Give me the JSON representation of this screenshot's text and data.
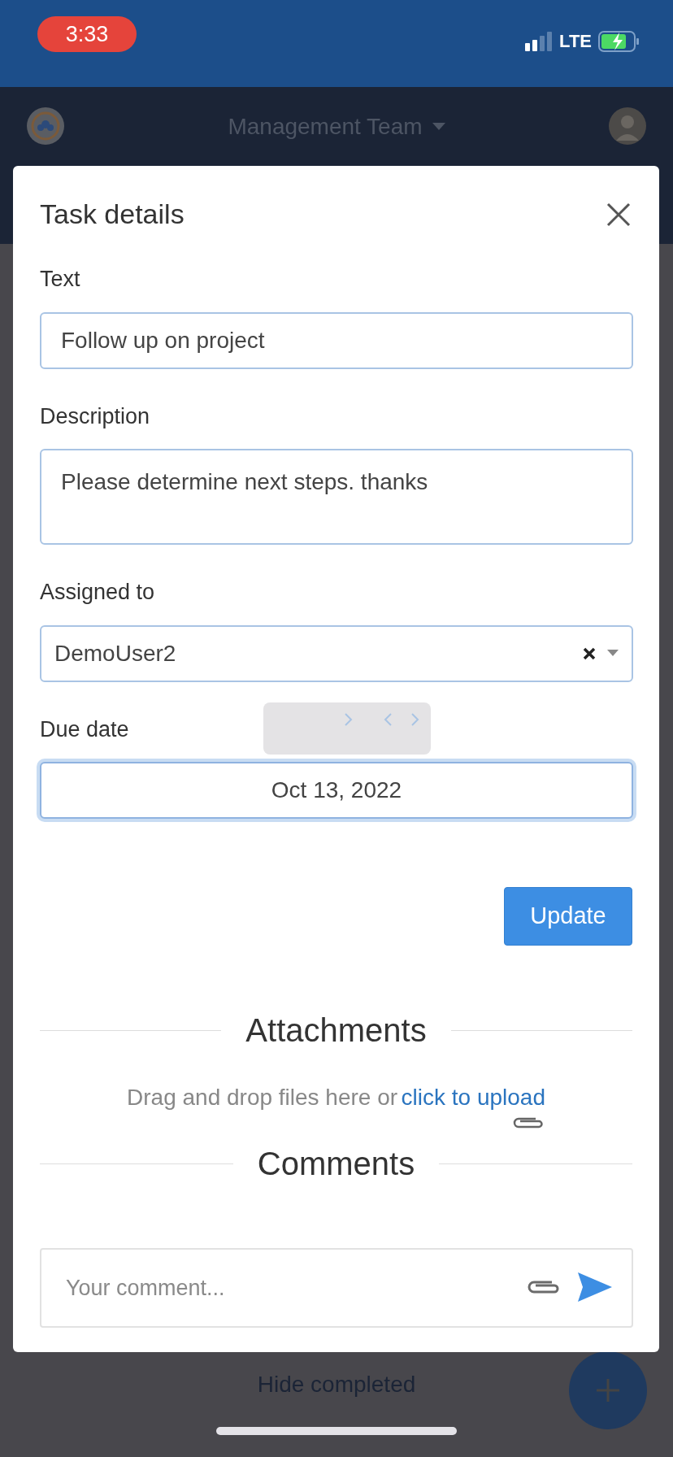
{
  "status_bar": {
    "time": "3:33",
    "network": "LTE"
  },
  "header": {
    "team": "Management Team"
  },
  "page": {
    "hide_completed": "Hide completed"
  },
  "modal": {
    "title": "Task details",
    "fields": [
      {
        "kind": "input",
        "label": "Text",
        "value": "Follow up on project",
        "focused": false
      },
      {
        "kind": "textarea",
        "label": "Description",
        "value": "Please determine next steps. thanks",
        "focused": false
      },
      {
        "kind": "select",
        "label": "Assigned to",
        "value": "DemoUser2",
        "focused": false
      },
      {
        "kind": "date",
        "label": "Due date",
        "value": "Oct 13, 2022",
        "focused": true
      }
    ],
    "update_button": "Update",
    "attachments": {
      "heading": "Attachments",
      "text": "Drag and drop files here or",
      "link": "click to upload"
    },
    "comments": {
      "heading": "Comments",
      "placeholder": "Your comment..."
    }
  }
}
